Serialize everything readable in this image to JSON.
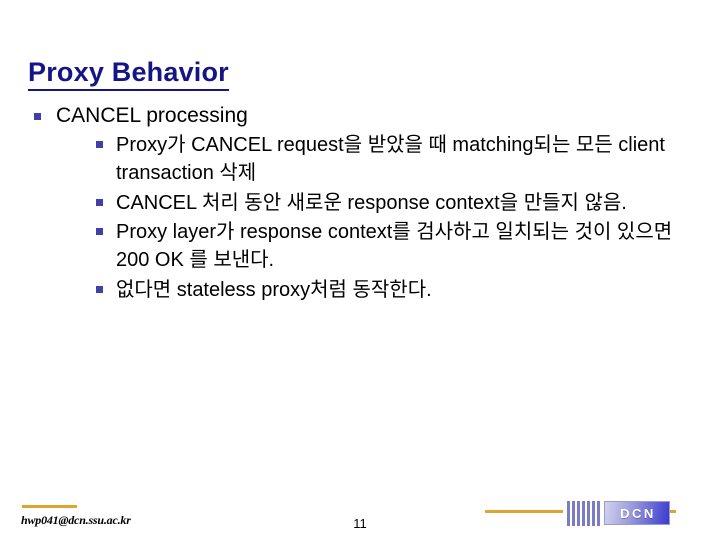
{
  "slide": {
    "title": "Proxy Behavior",
    "bullets": [
      {
        "level": 1,
        "text": "CANCEL processing",
        "children": [
          {
            "level": 2,
            "text": "Proxy가 CANCEL request을 받았을 때 matching되는 모든 client transaction 삭제"
          },
          {
            "level": 2,
            "text": "CANCEL 처리 동안 새로운 response context을 만들지 않음."
          },
          {
            "level": 2,
            "text": "Proxy layer가 response context를 검사하고 일치되는 것이 있으면 200 OK 를 보낸다."
          },
          {
            "level": 2,
            "text": "없다면 stateless proxy처럼 동작한다."
          }
        ]
      }
    ]
  },
  "footer": {
    "email": "hwp041@dcn.ssu.ac.kr",
    "page_number": "11",
    "logo_text": "DCN"
  },
  "colors": {
    "title": "#151585",
    "bullet_square": "#4040a8",
    "footer_rule": "#e0a32e",
    "logo_bar": "#7b7bc6",
    "logo_box_end": "#3a3ad0"
  }
}
